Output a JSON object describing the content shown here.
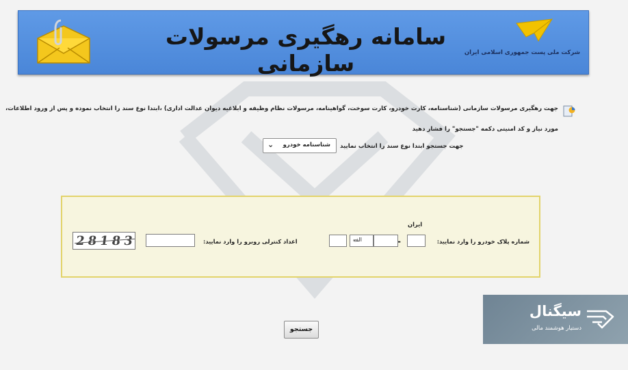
{
  "banner": {
    "title": "سامانه رهگیری مرسولات سازمانی",
    "company": "شرکت ملی پست جمهوری اسلامی ایران",
    "brand_colors": {
      "banner_blue": "#5b95e3",
      "logo_yellow": "#f2c200"
    }
  },
  "instructions": {
    "line1": "جهت رهگیری مرسولات سازمانی (شناسنامه، کارت خودرو، کارت سوخت، گواهینامه، مرسولات نظام وظیفه و ابلاغیه دیوان عدالت اداری) ،ابتدا نوع سند را انتخاب نموده و پس از ورود اطلاعات،",
    "line2": "مورد نیاز و کد امنیتی دکمه \"جستجو\" را فشار دهید",
    "select_label": "جهت جستجو ابتدا نوع سند را انتخاب نمایید",
    "select_value": "شناسنامه خودرو"
  },
  "form": {
    "plate_label": "شماره پلاک خودرو را وارد نمایید:",
    "iran_label": "ایران",
    "plate_dash": "-",
    "plate_letter_value": "الف",
    "captcha_label": "اعداد کنترلی روبرو را وارد نمایید:",
    "captcha_code": "28183"
  },
  "actions": {
    "search_label": "جستجو"
  },
  "badge": {
    "name": "سیگنال",
    "tagline": "دستیار هوشمند مالی"
  },
  "icons": [
    "envelope-icon",
    "post-logo-icon",
    "document-icon",
    "chevron-down-icon",
    "signal-logo-icon"
  ]
}
